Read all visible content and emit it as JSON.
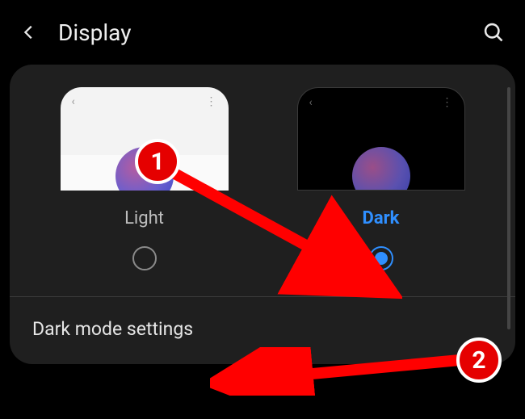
{
  "header": {
    "title": "Display"
  },
  "themes": {
    "light": {
      "label": "Light",
      "selected": false
    },
    "dark": {
      "label": "Dark",
      "selected": true
    }
  },
  "dark_mode_row": {
    "label": "Dark mode settings"
  },
  "annotations": {
    "badge1": "1",
    "badge2": "2"
  }
}
